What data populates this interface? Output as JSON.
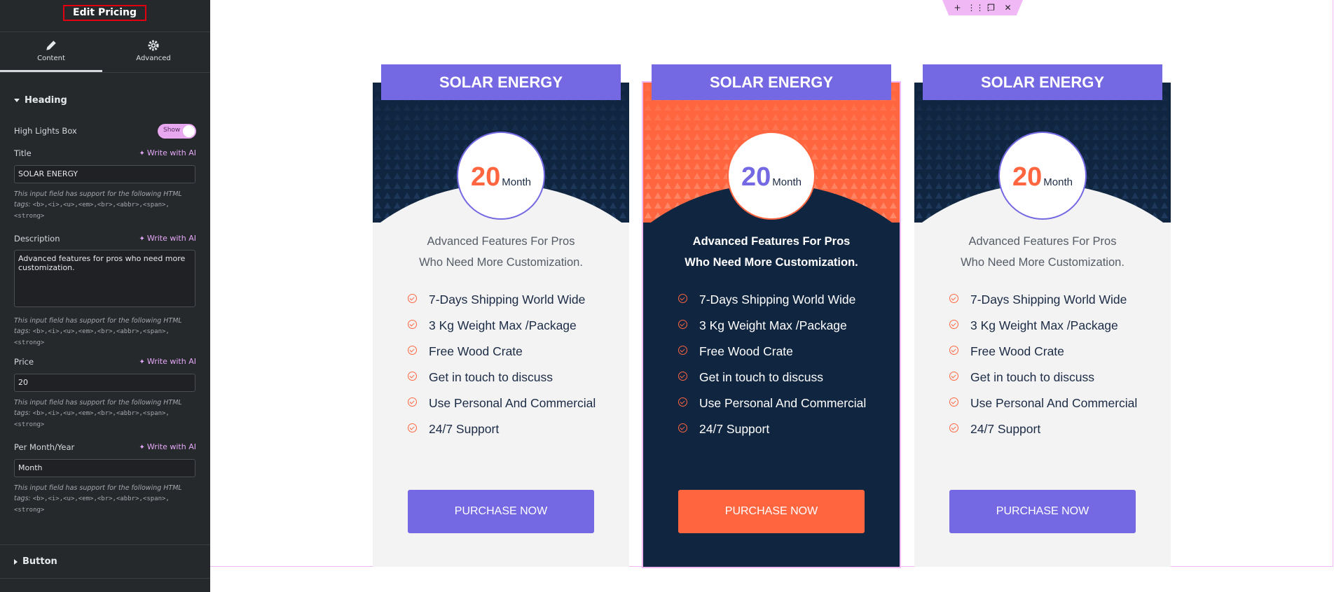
{
  "editor": {
    "title": "Edit Pricing",
    "tabs": [
      {
        "label": "Content",
        "icon": "pencil-icon"
      },
      {
        "label": "Advanced",
        "icon": "gear-icon"
      }
    ],
    "sections": {
      "heading": "Heading",
      "button": "Button"
    },
    "controls": {
      "highlights_label": "High Lights Box",
      "highlights_toggle": "Show",
      "write_ai": "Write with AI",
      "title_label": "Title",
      "title_value": "SOLAR ENERGY",
      "description_label": "Description",
      "description_value": "Advanced features for pros who need more customization.",
      "price_label": "Price",
      "price_value": "20",
      "period_label": "Per Month/Year",
      "period_value": "Month",
      "hint_prefix": "This input field has support for the following HTML tags:",
      "hint_tags": "<b>,<i>,<u>,<em>,<br>,<abbr>,<span>,<strong>"
    }
  },
  "canvas_toolbar": [
    "+",
    "⋮⋮⋮",
    "❐",
    "✕"
  ],
  "cards": [
    {
      "title": "SOLAR ENERGY",
      "price": "20",
      "period": "Month",
      "desc_line1": "Advanced Features For Pros",
      "desc_line2": "Who Need More Customization.",
      "features": [
        "7-Days Shipping World Wide",
        "3 Kg Weight Max /Package",
        "Free Wood Crate",
        "Get in touch to discuss",
        "Use Personal And Commercial",
        "24/7 Support"
      ],
      "button": "PURCHASE NOW"
    },
    {
      "title": "SOLAR ENERGY",
      "price": "20",
      "period": "Month",
      "desc_line1": "Advanced Features For Pros",
      "desc_line2": "Who Need More Customization.",
      "features": [
        "7-Days Shipping World Wide",
        "3 Kg Weight Max /Package",
        "Free Wood Crate",
        "Get in touch to discuss",
        "Use Personal And Commercial",
        "24/7 Support"
      ],
      "button": "PURCHASE NOW"
    },
    {
      "title": "SOLAR ENERGY",
      "price": "20",
      "period": "Month",
      "desc_line1": "Advanced Features For Pros",
      "desc_line2": "Who Need More Customization.",
      "features": [
        "7-Days Shipping World Wide",
        "3 Kg Weight Max /Package",
        "Free Wood Crate",
        "Get in touch to discuss",
        "Use Personal And Commercial",
        "24/7 Support"
      ],
      "button": "PURCHASE NOW"
    }
  ],
  "colors": {
    "panel_bg": "#26292c",
    "accent_purple": "#7468e3",
    "accent_orange": "#ff6640",
    "navy": "#102540",
    "selection_pink": "#f0b8f5"
  }
}
